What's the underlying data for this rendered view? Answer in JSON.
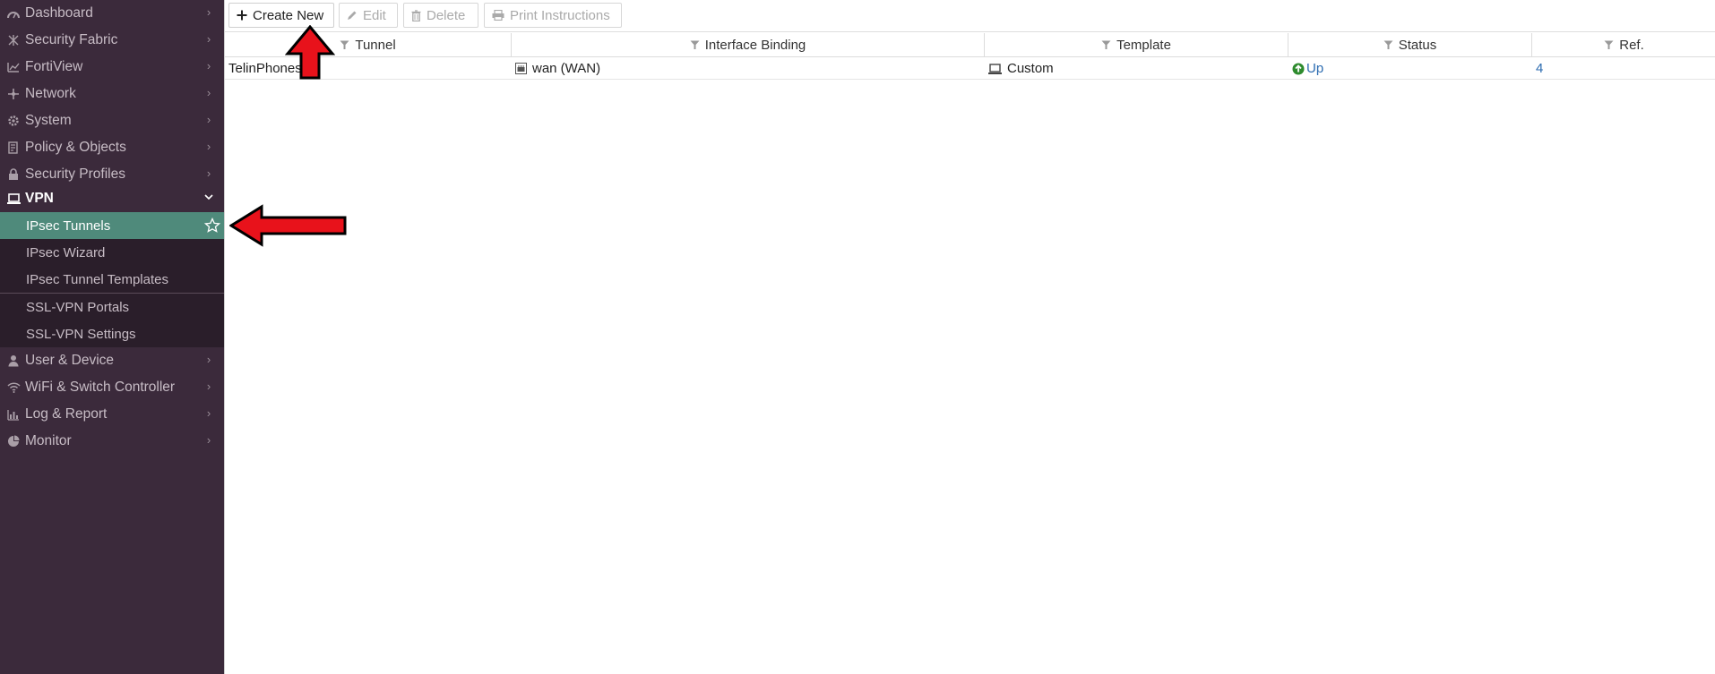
{
  "sidebar": {
    "items_top": [
      {
        "label": "Dashboard",
        "icon": "dashboard-icon"
      },
      {
        "label": "Security Fabric",
        "icon": "security-fabric-icon"
      },
      {
        "label": "FortiView",
        "icon": "fortiview-icon"
      },
      {
        "label": "Network",
        "icon": "network-icon"
      },
      {
        "label": "System",
        "icon": "gear-icon"
      },
      {
        "label": "Policy & Objects",
        "icon": "policy-icon"
      },
      {
        "label": "Security Profiles",
        "icon": "lock-icon"
      }
    ],
    "vpn": {
      "label": "VPN",
      "icon": "laptop-icon"
    },
    "vpn_sub": [
      {
        "label": "IPsec Tunnels",
        "active": true
      },
      {
        "label": "IPsec Wizard"
      },
      {
        "label": "IPsec Tunnel Templates"
      },
      {
        "label": "SSL-VPN Portals"
      },
      {
        "label": "SSL-VPN Settings"
      }
    ],
    "items_bottom": [
      {
        "label": "User & Device",
        "icon": "user-icon"
      },
      {
        "label": "WiFi & Switch Controller",
        "icon": "wifi-icon"
      },
      {
        "label": "Log & Report",
        "icon": "chart-icon"
      },
      {
        "label": "Monitor",
        "icon": "pie-icon"
      }
    ]
  },
  "toolbar": {
    "create_new": "Create New",
    "edit": "Edit",
    "delete": "Delete",
    "print": "Print Instructions"
  },
  "table": {
    "columns": [
      "Tunnel",
      "Interface Binding",
      "Template",
      "Status",
      "Ref."
    ],
    "rows": [
      {
        "tunnel": "TelinPhones",
        "interface": "wan (WAN)",
        "template": "Custom",
        "status": "Up",
        "ref": "4"
      }
    ]
  },
  "colors": {
    "sidebar_bg": "#3b2a3b",
    "submenu_bg": "#2a1e2a",
    "active_bg": "#4f8a7b",
    "status_up": "#2b6bb0",
    "arrow": "#e8121b"
  }
}
